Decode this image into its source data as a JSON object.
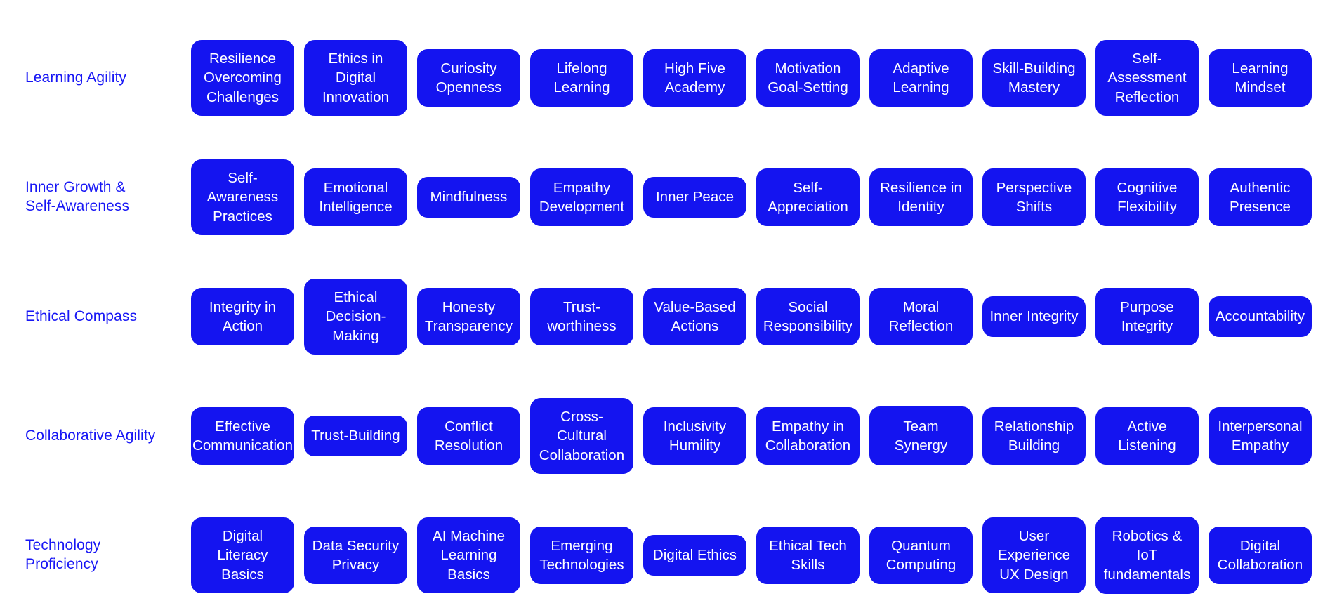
{
  "theme": {
    "background": "#ffffff",
    "card_fill": "#1414f0",
    "card_text": "#ffffff",
    "row_label_color": "#1716f5"
  },
  "rows": [
    {
      "label": "Learning Agility",
      "cards": [
        "Resilience\nOvercoming\nChallenges",
        "Ethics in\nDigital\nInnovation",
        "Curiosity\nOpenness",
        "Lifelong\nLearning",
        "High Five\nAcademy",
        "Motivation\nGoal-Setting",
        "Adaptive\nLearning",
        "Skill-Building\nMastery",
        "Self-\nAssessment\nReflection",
        "Learning\nMindset"
      ]
    },
    {
      "label": "Inner Growth &\nSelf-Awareness",
      "cards": [
        "Self-\nAwareness\nPractices",
        "Emotional\nIntelligence",
        "Mindfulness",
        "Empathy\nDevelopment",
        "Inner Peace",
        "Self-\nAppreciation",
        "Resilience in\nIdentity",
        "Perspective\nShifts",
        "Cognitive\nFlexibility",
        "Authentic\nPresence"
      ]
    },
    {
      "label": "Ethical Compass",
      "cards": [
        "Integrity in\nAction",
        "Ethical\nDecision-\nMaking",
        "Honesty\nTransparency",
        "Trust-\nworthiness",
        "Value-Based\nActions",
        "Social\nResponsibility",
        "Moral\nReflection",
        "Inner Integrity",
        "Purpose\nIntegrity",
        "Accountability"
      ]
    },
    {
      "label": "Collaborative Agility",
      "cards": [
        "Effective\nCommunication",
        "Trust-Building",
        "Conflict\nResolution",
        "Cross-\nCultural\nCollaboration",
        "Inclusivity\nHumility",
        "Empathy in\nCollaboration",
        "Team Synergy",
        "Relationship\nBuilding",
        "Active\nListening",
        "Interpersonal\nEmpathy"
      ]
    },
    {
      "label": "Technology\nProficiency",
      "cards": [
        "Digital\nLiteracy\nBasics",
        "Data Security\nPrivacy",
        "AI Machine\nLearning\nBasics",
        "Emerging\nTechnologies",
        "Digital Ethics",
        "Ethical Tech\nSkills",
        "Quantum\nComputing",
        "User\nExperience\nUX Design",
        "Robotics & IoT\nfundamentals",
        "Digital\nCollaboration"
      ]
    }
  ]
}
